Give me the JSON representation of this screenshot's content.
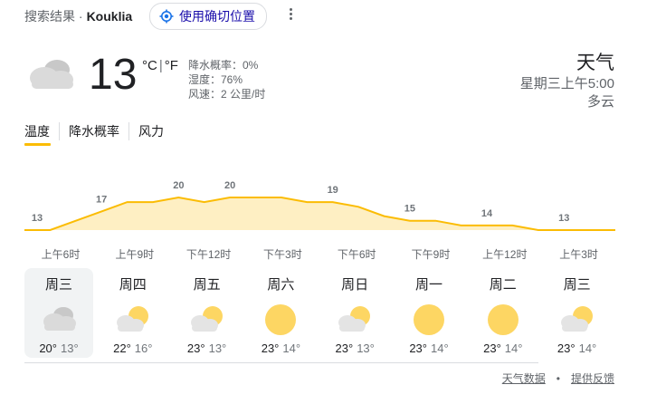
{
  "header": {
    "breadcrumb": "搜索结果 ·",
    "location": "Kouklia",
    "precise_location_label": "使用确切位置"
  },
  "current": {
    "temperature": "13",
    "unit_c": "°C",
    "unit_sep": "|",
    "unit_f": "°F",
    "precipitation": "降水概率：0%",
    "humidity": "湿度：76%",
    "wind": "风速：2 公里/时",
    "title": "天气",
    "datetime": "星期三上午5:00",
    "condition": "多云",
    "icon": "cloudy-icon"
  },
  "tabs": [
    {
      "label": "温度",
      "active": true
    },
    {
      "label": "降水概率",
      "active": false
    },
    {
      "label": "风力",
      "active": false
    }
  ],
  "chart_data": {
    "type": "area",
    "points": [
      {
        "value": 13,
        "label": "13"
      },
      {
        "value": 13,
        "label": ""
      },
      {
        "value": 15,
        "label": ""
      },
      {
        "value": 17,
        "label": "17"
      },
      {
        "value": 19,
        "label": ""
      },
      {
        "value": 19,
        "label": ""
      },
      {
        "value": 20,
        "label": "20"
      },
      {
        "value": 19,
        "label": ""
      },
      {
        "value": 20,
        "label": "20"
      },
      {
        "value": 20,
        "label": ""
      },
      {
        "value": 20,
        "label": ""
      },
      {
        "value": 19,
        "label": ""
      },
      {
        "value": 19,
        "label": "19"
      },
      {
        "value": 18,
        "label": ""
      },
      {
        "value": 16,
        "label": ""
      },
      {
        "value": 15,
        "label": "15"
      },
      {
        "value": 15,
        "label": ""
      },
      {
        "value": 14,
        "label": ""
      },
      {
        "value": 14,
        "label": "14"
      },
      {
        "value": 14,
        "label": ""
      },
      {
        "value": 13,
        "label": ""
      },
      {
        "value": 13,
        "label": "13"
      },
      {
        "value": 13,
        "label": ""
      },
      {
        "value": 13,
        "label": ""
      }
    ],
    "x_labels": [
      "上午6时",
      "上午9时",
      "下午12时",
      "下午3时",
      "下午6时",
      "下午9时",
      "上午12时",
      "上午3时"
    ],
    "color_line": "#fbbc04",
    "color_fill": "#feefc3"
  },
  "forecast": [
    {
      "day": "周三",
      "icon": "cloudy-icon",
      "high": "20°",
      "low": "13°",
      "selected": true
    },
    {
      "day": "周四",
      "icon": "partly-cloudy-icon",
      "high": "22°",
      "low": "16°",
      "selected": false
    },
    {
      "day": "周五",
      "icon": "partly-cloudy-icon",
      "high": "23°",
      "low": "13°",
      "selected": false
    },
    {
      "day": "周六",
      "icon": "sunny-icon",
      "high": "23°",
      "low": "14°",
      "selected": false
    },
    {
      "day": "周日",
      "icon": "partly-cloudy-icon",
      "high": "23°",
      "low": "13°",
      "selected": false
    },
    {
      "day": "周一",
      "icon": "sunny-icon",
      "high": "23°",
      "low": "14°",
      "selected": false
    },
    {
      "day": "周二",
      "icon": "sunny-icon",
      "high": "23°",
      "low": "14°",
      "selected": false
    },
    {
      "day": "周三",
      "icon": "partly-cloudy-icon",
      "high": "23°",
      "low": "14°",
      "selected": false
    }
  ],
  "footer": {
    "data_link": "天气数据",
    "dot": "•",
    "feedback_link": "提供反馈"
  }
}
